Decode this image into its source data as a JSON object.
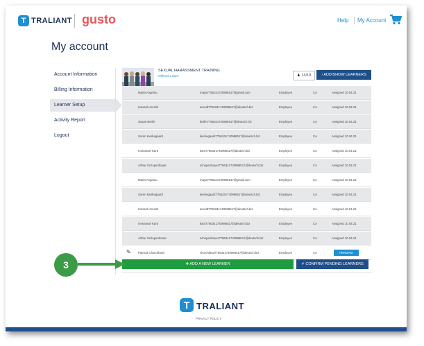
{
  "header": {
    "traliant_logo_mark": "T",
    "traliant_logo_text": "TRALIANT",
    "gusto_logo_text": "gusto",
    "help_label": "Help",
    "my_account_label": "My Account",
    "cart_icon": "shopping-cart-icon"
  },
  "page_title": "My account",
  "sidebar": {
    "items": [
      {
        "label": "Account Information",
        "active": false
      },
      {
        "label": "Billing Information",
        "active": false
      },
      {
        "label": "Learner Setup",
        "active": true
      },
      {
        "label": "Activity Report",
        "active": false
      },
      {
        "label": "Logout",
        "active": false
      }
    ]
  },
  "course": {
    "title": "SEXUAL HARASSMENT TRAINING",
    "subtitle": "Offered 4 days",
    "learner_count": "13/19",
    "add_show_label": "ADD/SHOW LEARNERS"
  },
  "learners": [
    {
      "name": "Maria Angelou",
      "email": "maya7756341740986517@gmail.com",
      "role": "Employee",
      "state": "CA",
      "status": "Assigned 10.04.21"
    },
    {
      "name": "Hannah Arendt",
      "email": "arendt7756341740986517@deutsch.biz",
      "role": "Employee",
      "state": "CA",
      "status": "Assigned 10.04.21"
    },
    {
      "name": "Susan Berlin",
      "email": "berlin7756341740986517@deutsch.biz",
      "role": "Employee",
      "state": "CA",
      "status": "Assigned 10.04.21"
    },
    {
      "name": "Soren Kierkegaard",
      "email": "kierkegaard7756341740986517@deutsch.biz",
      "role": "Employee",
      "state": "CA",
      "status": "Assigned 10.04.21"
    },
    {
      "name": "Immanuel Kant",
      "email": "kant7756341740986517@deutsch.biz",
      "role": "Employee",
      "state": "CA",
      "status": "Assigned 10.04.21"
    },
    {
      "name": "Arthur Schopenhauer",
      "email": "schopenhauer7756341740986517@deutsch.biz",
      "role": "Employee",
      "state": "CA",
      "status": "Assigned 10.04.21"
    },
    {
      "name": "Maria Angelou",
      "email": "maya7756341740986517@gmail.com",
      "role": "Employee",
      "state": "CA",
      "status": "Assigned 10.04.21"
    },
    {
      "name": "Soren Kierkegaard",
      "email": "kierkegaard7756341740986517@deutsch.biz",
      "role": "Employee",
      "state": "CA",
      "status": "Assigned 10.04.21"
    },
    {
      "name": "Hannah Arendt",
      "email": "arendt7756341740986517@deutsch.biz",
      "role": "Employee",
      "state": "CA",
      "status": "Assigned 10.04.21"
    },
    {
      "name": "Immanuel Kant",
      "email": "kant7756341740986517@deutsch.biz",
      "role": "Employee",
      "state": "CA",
      "status": "Assigned 10.04.21"
    },
    {
      "name": "Arthur Schopenhauer",
      "email": "schopenhauer7756341740986517@deutsch.biz",
      "role": "Employee",
      "state": "CA",
      "status": "Assigned 10.04.21"
    },
    {
      "name": "Patricia Churchland",
      "email": "churchland7756341740986517@deutsch.biz",
      "role": "Employee",
      "state": "CA",
      "status": "PENDING",
      "pending": true
    }
  ],
  "actions": {
    "add_new_learner": "ADD A NEW LEARNER",
    "confirm_pending": "CONFIRM PENDING LEARNERS"
  },
  "callout": {
    "step_number": "3",
    "color": "#3d9b48"
  },
  "footer": {
    "logo_mark": "T",
    "logo_text": "TRALIANT",
    "privacy_label": "PRIVACY POLICY"
  },
  "colors": {
    "navy": "#1b2f54",
    "blue": "#1e8fd0",
    "button_blue": "#1f4f8b",
    "green": "#1f9c3f",
    "gusto_red": "#e8555a"
  }
}
